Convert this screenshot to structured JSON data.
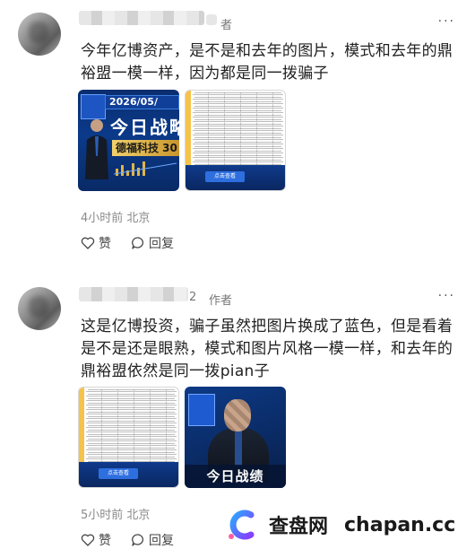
{
  "posts": [
    {
      "author_tag": "者",
      "more_icon": "···",
      "text": "今年亿博资产，是不是和去年的图片，模式和去年的鼎裕盟一模一样，因为都是同一拨骗子",
      "thumb1": {
        "date": "2026/05/",
        "headline": "今日战略",
        "gold": "德福科技 30"
      },
      "thumb2": {
        "button": "点击查看"
      },
      "meta": "4小时前 北京",
      "like_label": "赞",
      "reply_label": "回复"
    },
    {
      "author_tag": "作者",
      "author_suffix": "2",
      "more_icon": "···",
      "text": "这是亿博投资，骗子虽然把图片换成了蓝色，但是看着是不是还是眼熟，模式和图片风格一模一样，和去年的鼎裕盟依然是同一拨pian子",
      "thumb1": {
        "button": "点击查看"
      },
      "thumb2": {
        "banner": "今日战绩"
      },
      "meta": "5小时前 北京",
      "like_label": "赞",
      "reply_label": "回复"
    }
  ],
  "watermark": {
    "brand": "查盘网",
    "url": "chapan.cc"
  },
  "colors": {
    "poster_blue": "#0b3a8a",
    "gold": "#e0b548",
    "meta_gray": "#8a8a8a"
  }
}
